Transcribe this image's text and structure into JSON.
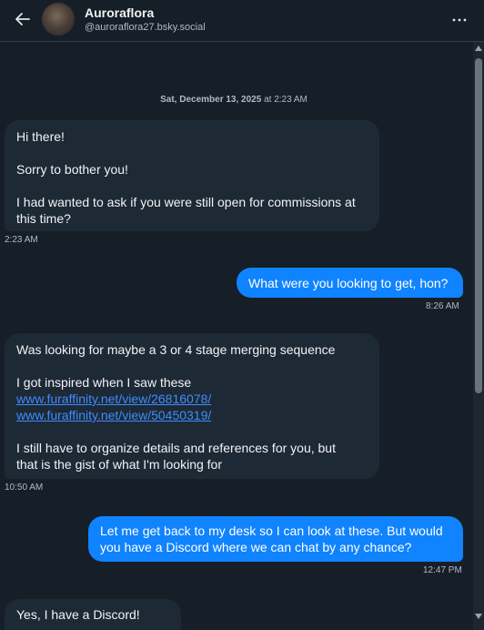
{
  "header": {
    "name": "Auroraflora",
    "handle": "@auroraflora27.bsky.social"
  },
  "date_separator": {
    "date": "Sat, December 13, 2025",
    "at": " at 2:23 AM"
  },
  "messages": [
    {
      "direction": "incoming",
      "lines": [
        "Hi there!",
        "",
        "Sorry to bother you!",
        "",
        "I had wanted to ask if you were still open for commissions at",
        "this time?"
      ],
      "time": "2:23 AM"
    },
    {
      "direction": "outgoing",
      "lines": [
        "What were you looking to get, hon?"
      ],
      "time": "8:26 AM"
    },
    {
      "direction": "incoming",
      "lines": [
        "Was looking for maybe a 3 or 4 stage merging sequence",
        "",
        "I got inspired when I saw these"
      ],
      "links": [
        "www.furaffinity.net/view/26816078/",
        "www.furaffinity.net/view/50450319/"
      ],
      "lines_after": [
        "",
        "I still have to organize details and references for you, but",
        "that is the gist of what I'm looking for"
      ],
      "time": "10:50 AM"
    },
    {
      "direction": "outgoing",
      "lines": [
        "Let me get back to my desk so I can look at these. But would",
        "you have a Discord where we can chat by any chance?"
      ],
      "time": "12:47 PM"
    },
    {
      "direction": "incoming",
      "lines": [
        "Yes, I have a Discord!"
      ]
    }
  ],
  "icons": {
    "back": "arrow-left-icon",
    "more": "ellipsis-icon"
  },
  "colors": {
    "background": "#161e27",
    "incoming_bubble": "#1e2936",
    "outgoing_bubble": "#1083fe",
    "link": "#3d8cff",
    "muted_text": "#aebbc9"
  }
}
